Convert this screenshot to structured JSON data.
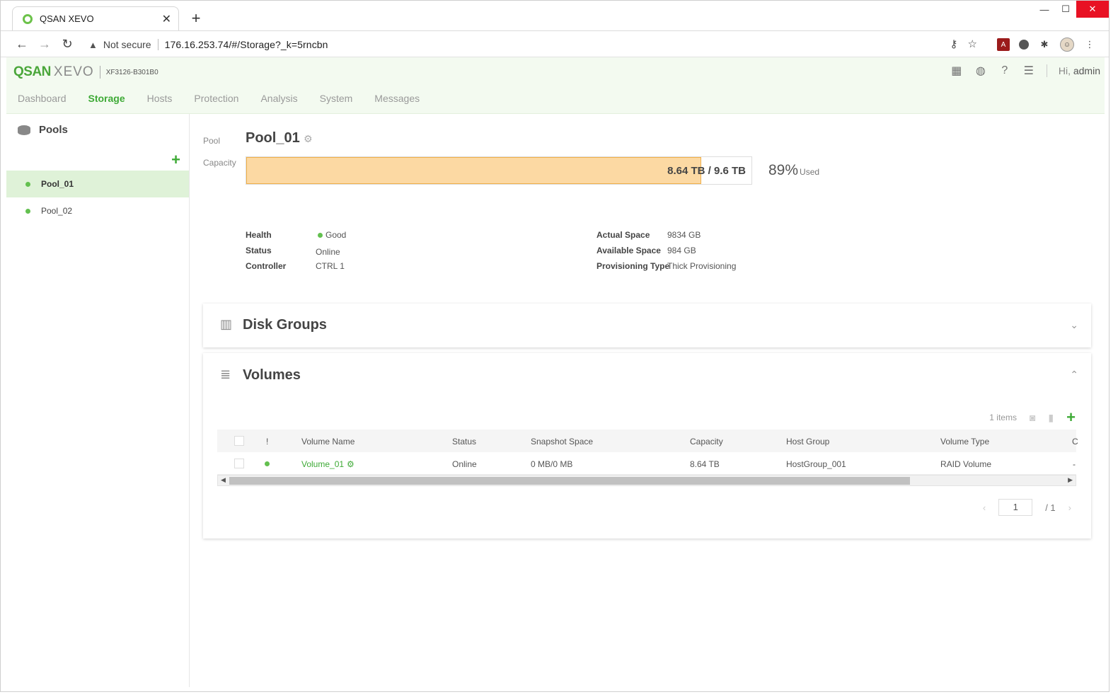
{
  "browser": {
    "tab_title": "QSAN XEVO",
    "not_secure": "Not secure",
    "url": "176.16.253.74/#/Storage?_k=5rncbn"
  },
  "header": {
    "logo_qsan": "QSAN",
    "logo_xevo": "XEVO",
    "model": "XF3126-B301B0",
    "greeting_prefix": "Hi,",
    "user": "admin"
  },
  "nav": {
    "tabs": [
      "Dashboard",
      "Storage",
      "Hosts",
      "Protection",
      "Analysis",
      "System",
      "Messages"
    ],
    "active": "Storage"
  },
  "sidebar": {
    "title": "Pools",
    "pools": [
      "Pool_01",
      "Pool_02"
    ],
    "active": "Pool_01"
  },
  "pool": {
    "label": "Pool",
    "name": "Pool_01",
    "capacity_label": "Capacity",
    "capacity_text": "8.64 TB / 9.6 TB",
    "used_fraction": 0.9,
    "used_percent": "89",
    "used_unit": "%",
    "used_suffix": "Used",
    "info": {
      "health_key": "Health",
      "health_val": "Good",
      "status_key": "Status",
      "status_val": "Online",
      "controller_key": "Controller",
      "controller_val": "CTRL 1",
      "actual_key": "Actual Space",
      "actual_val": "9834 GB",
      "available_key": "Available Space",
      "available_val": "984 GB",
      "prov_key": "Provisioning Type",
      "prov_val": "Thick Provisioning"
    }
  },
  "disk_groups": {
    "title": "Disk Groups"
  },
  "volumes": {
    "title": "Volumes",
    "count": "1 items",
    "columns": {
      "alert": "!",
      "name": "Volume Name",
      "status": "Status",
      "snapshot": "Snapshot Space",
      "capacity": "Capacity",
      "host_group": "Host Group",
      "type": "Volume Type",
      "more": "C"
    },
    "rows": [
      {
        "name": "Volume_01",
        "status": "Online",
        "snapshot": "0 MB/0 MB",
        "capacity": "8.64 TB",
        "host_group": "HostGroup_001",
        "type": "RAID Volume",
        "more": "-"
      }
    ],
    "pager": {
      "page": "1",
      "total": "/ 1"
    }
  }
}
